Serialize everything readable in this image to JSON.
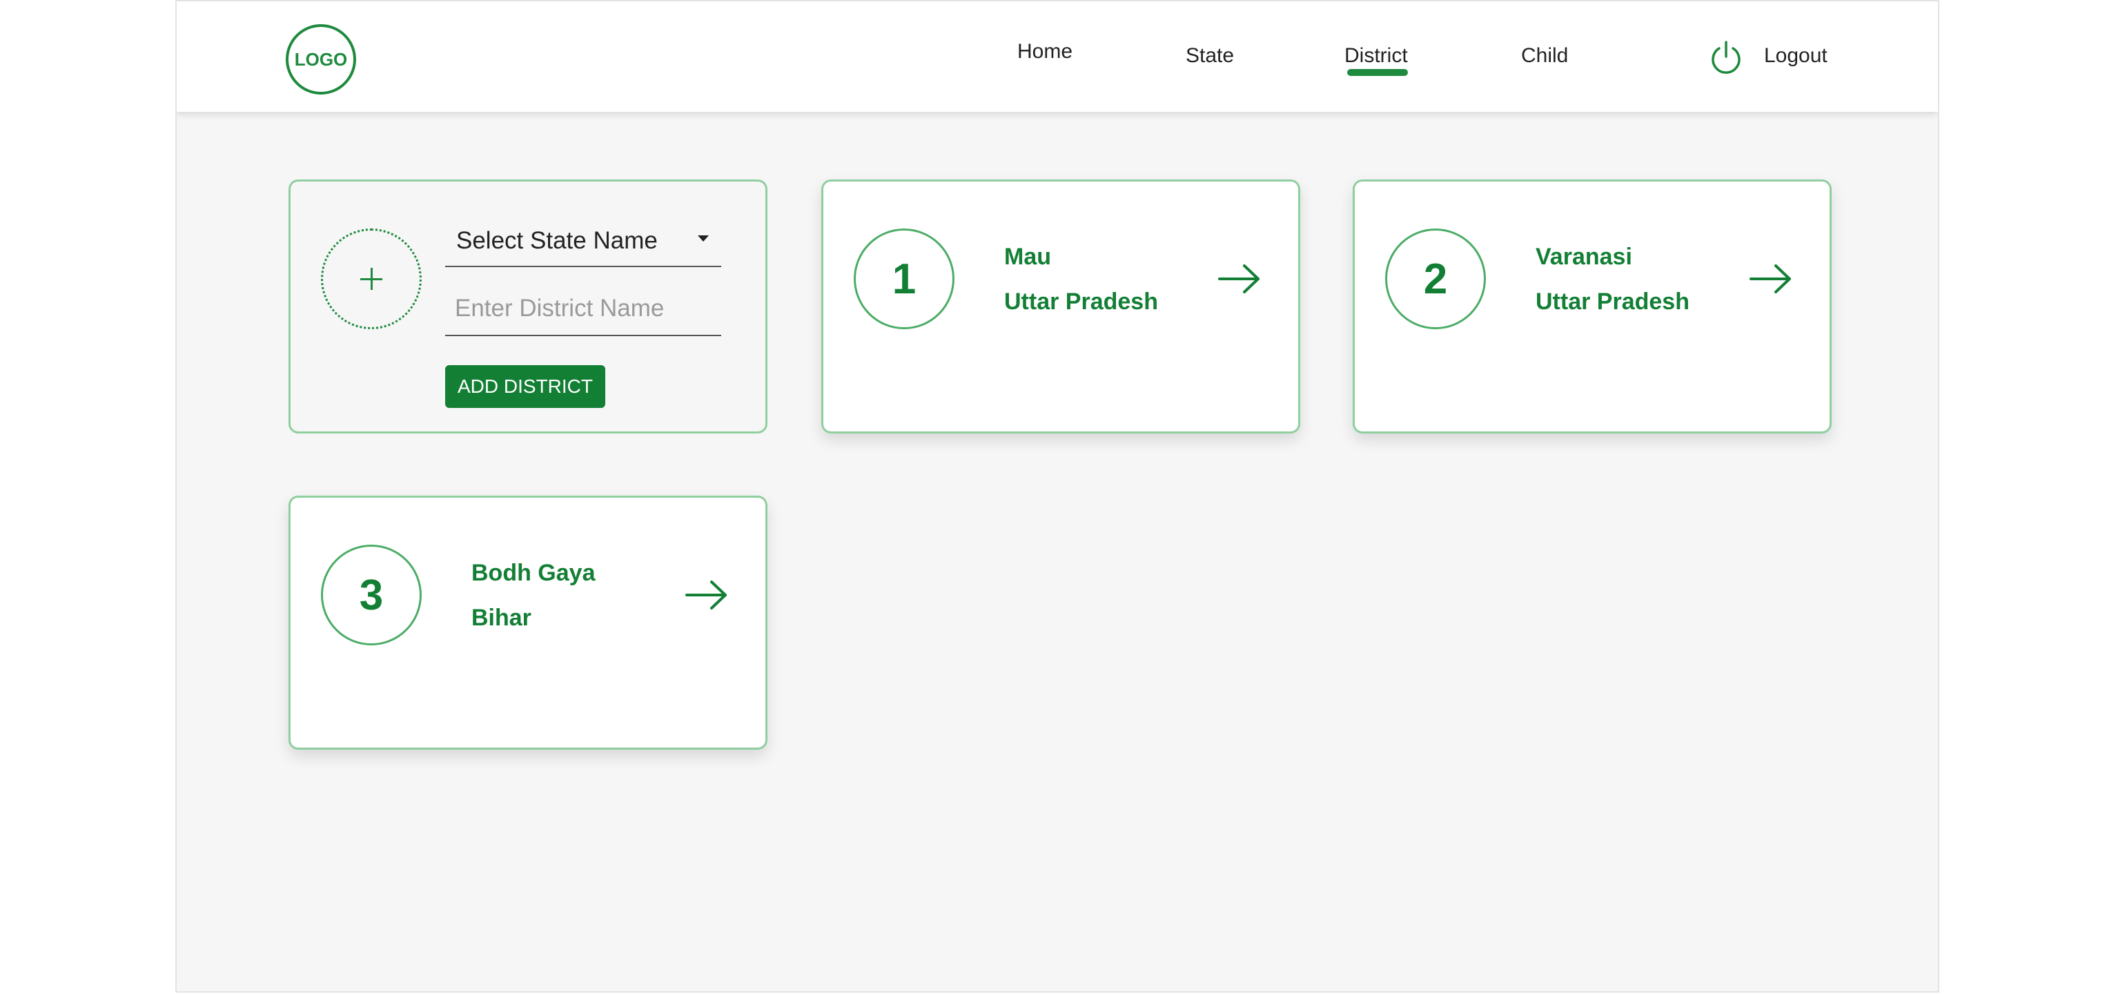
{
  "nav": {
    "logo_text": "LOGO",
    "links": [
      "Home",
      "State",
      "District",
      "Child"
    ],
    "active": "District",
    "logout_label": "Logout"
  },
  "add_form": {
    "select_placeholder": "Select State Name",
    "district_placeholder": "Enter District Name",
    "button_label": "ADD DISTRICT"
  },
  "districts": [
    {
      "number": "1",
      "district": "Mau",
      "state": "Uttar Pradesh"
    },
    {
      "number": "2",
      "district": "Varanasi",
      "state": "Uttar Pradesh"
    },
    {
      "number": "3",
      "district": "Bodh Gaya",
      "state": "Bihar"
    }
  ],
  "colors": {
    "accent": "#137f35",
    "card_border": "#8fcf9f",
    "background": "#f6f6f6"
  },
  "icons": {
    "logout": "power-icon",
    "open_district": "arrow-right-icon",
    "add": "plus-icon",
    "select": "caret-down-icon"
  }
}
